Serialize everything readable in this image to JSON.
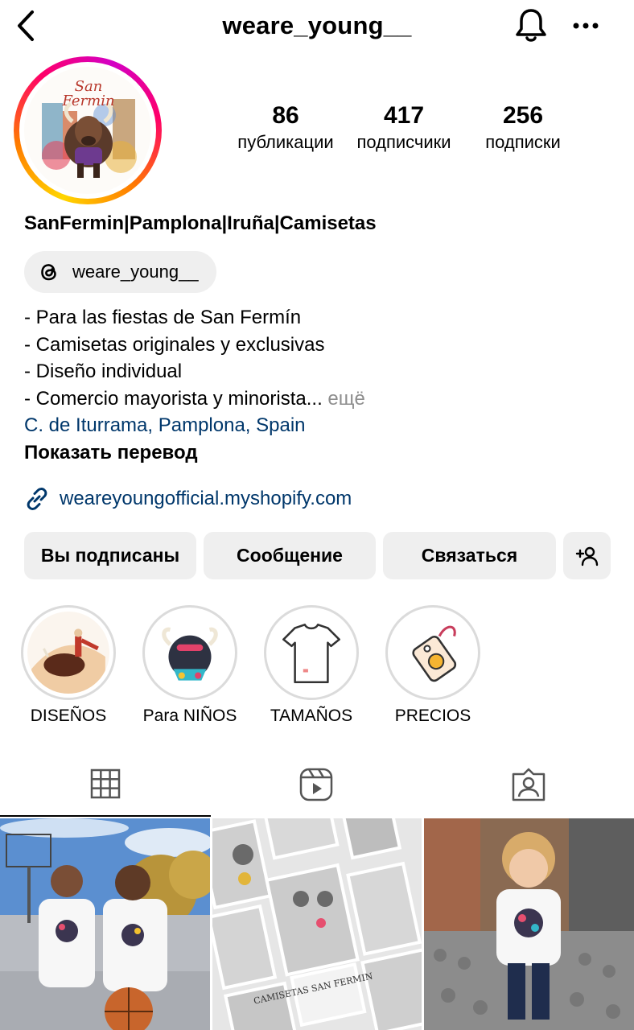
{
  "header": {
    "username": "weare_young__",
    "back_icon": "chevron-left-icon",
    "bell_icon": "bell-icon",
    "more_icon": "more-horizontal-icon"
  },
  "profile": {
    "avatar_text": "San Fermin",
    "stats": [
      {
        "value": "86",
        "label": "публикации"
      },
      {
        "value": "417",
        "label": "подписчики"
      },
      {
        "value": "256",
        "label": "подписки"
      }
    ],
    "display_name": "SanFermin|Pamplona|Iruña|Camisetas",
    "threads_handle": "weare_young__",
    "bio_lines": [
      "- Para las fiestas de San Fermín",
      "- Camisetas originales y exclusivas",
      "- Diseño individual",
      "- Comercio mayorista y minorista..."
    ],
    "bio_more": "ещё",
    "location": "C. de Iturrama, Pamplona, Spain",
    "translate": "Показать перевод",
    "link": "weareyoungofficial.myshopify.com"
  },
  "buttons": {
    "following": "Вы подписаны",
    "message": "Сообщение",
    "contact": "Связаться",
    "add_user_icon": "add-user-icon"
  },
  "highlights": [
    {
      "label": "DISEÑOS"
    },
    {
      "label": "Para NIÑOS"
    },
    {
      "label": "TAMAÑOS"
    },
    {
      "label": "PRECIOS"
    }
  ],
  "tabs": [
    {
      "icon": "grid-icon",
      "active": true
    },
    {
      "icon": "reels-icon",
      "active": false
    },
    {
      "icon": "tagged-icon",
      "active": false
    }
  ],
  "grid_post_2_text": "CAMISETAS SAN FERMIN",
  "colors": {
    "link_blue": "#00376b",
    "button_bg": "#efefef",
    "muted": "#8e8e8e"
  }
}
